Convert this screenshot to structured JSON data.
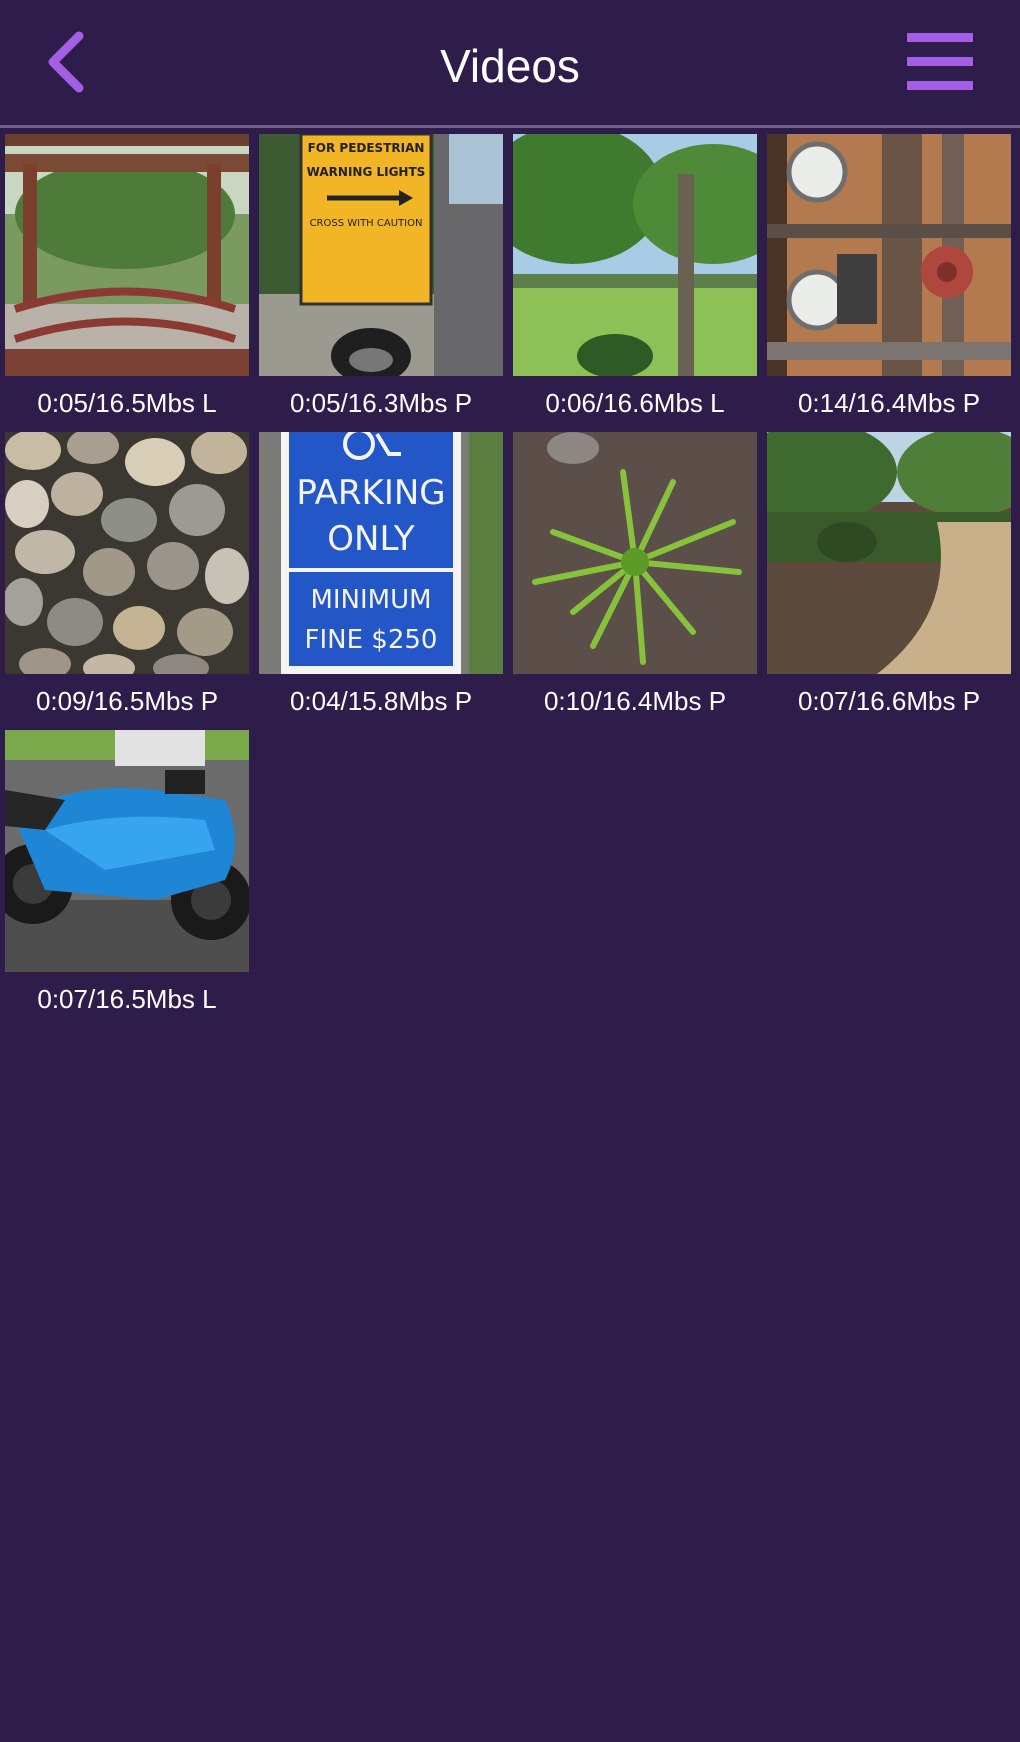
{
  "header": {
    "title": "Videos",
    "back_icon": "chevron-left-icon",
    "menu_icon": "hamburger-menu-icon",
    "accent_color": "#a35ee6",
    "background_color": "#2e1d4b"
  },
  "videos": [
    {
      "caption": "0:05/16.5Mbs L",
      "thumbnail": "garden-footbridge"
    },
    {
      "caption": "0:05/16.3Mbs P",
      "thumbnail": "pedestrian-warning-sign"
    },
    {
      "caption": "0:06/16.6Mbs L",
      "thumbnail": "tree-lawn"
    },
    {
      "caption": "0:14/16.4Mbs P",
      "thumbnail": "pipes-gauges"
    },
    {
      "caption": "0:09/16.5Mbs P",
      "thumbnail": "river-rocks"
    },
    {
      "caption": "0:04/15.8Mbs P",
      "thumbnail": "handicap-parking-sign"
    },
    {
      "caption": "0:10/16.4Mbs P",
      "thumbnail": "green-plant-mulch"
    },
    {
      "caption": "0:07/16.6Mbs P",
      "thumbnail": "garden-path"
    },
    {
      "caption": "0:07/16.5Mbs L",
      "thumbnail": "blue-motorcycle"
    }
  ],
  "sign_text": {
    "pedestrian_line1": "FOR PEDESTRIAN",
    "pedestrian_line2": "WARNING LIGHTS",
    "pedestrian_line3": "CROSS WITH CAUTION",
    "parking_line1": "PARKING",
    "parking_line2": "ONLY",
    "parking_line3": "MINIMUM",
    "parking_line4": "FINE $250"
  }
}
